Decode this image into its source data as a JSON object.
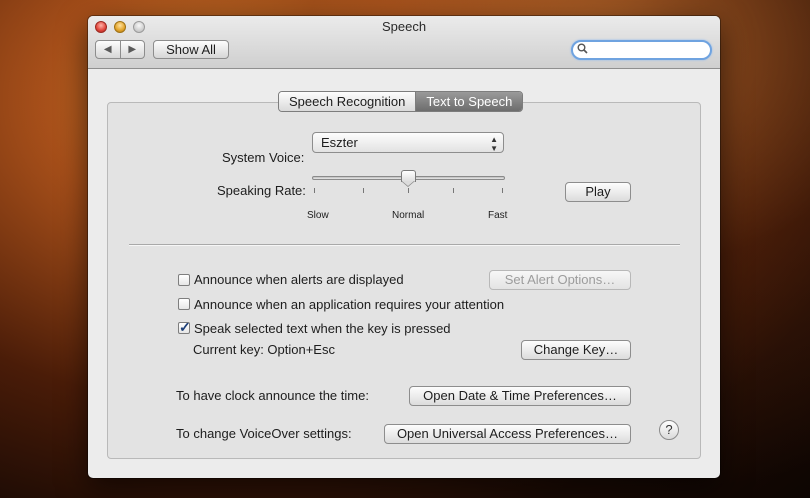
{
  "window": {
    "title": "Speech"
  },
  "toolbar": {
    "back_icon": "◀",
    "forward_icon": "▶",
    "show_all_label": "Show All",
    "search_value": "",
    "search_placeholder": ""
  },
  "tabs": [
    {
      "label": "Speech Recognition",
      "active": false
    },
    {
      "label": "Text to Speech",
      "active": true
    }
  ],
  "voice": {
    "label": "System Voice:",
    "selected": "Eszter"
  },
  "rate": {
    "label": "Speaking Rate:",
    "slow_label": "Slow",
    "normal_label": "Normal",
    "fast_label": "Fast",
    "position": 0.5,
    "play_label": "Play"
  },
  "options": {
    "announce_alerts": {
      "label": "Announce when alerts are displayed",
      "checked": false
    },
    "set_alert_options_label": "Set Alert Options…",
    "announce_attention": {
      "label": "Announce when an application requires your attention",
      "checked": false
    },
    "speak_selected": {
      "label": "Speak selected text when the key is pressed",
      "checked": true
    },
    "current_key_label": "Current key: Option+Esc",
    "change_key_label": "Change Key…"
  },
  "clock": {
    "label": "To have clock announce the time:",
    "button_label": "Open Date & Time Preferences…"
  },
  "voiceover": {
    "label": "To change VoiceOver settings:",
    "button_label": "Open Universal Access Preferences…"
  },
  "help_label": "?"
}
